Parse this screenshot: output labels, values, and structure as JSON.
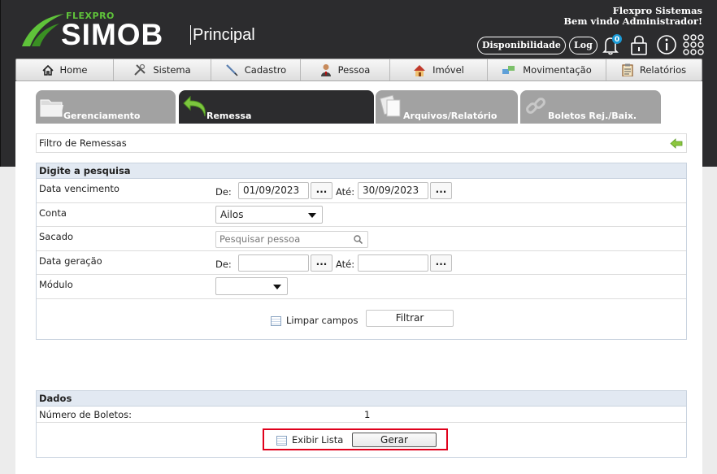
{
  "brand": {
    "small": "FLEXPRO",
    "name": "SIMOB",
    "module": "Principal"
  },
  "user": {
    "company": "Flexpro Sistemas",
    "welcome": "Bem vindo Administrador!"
  },
  "top_actions": {
    "availability": "Disponibilidade",
    "log": "Log",
    "notifications_count": "0"
  },
  "menu": [
    {
      "label": "Home",
      "icon": "home-icon"
    },
    {
      "label": "Sistema",
      "icon": "tools-icon"
    },
    {
      "label": "Cadastro",
      "icon": "pen-icon"
    },
    {
      "label": "Pessoa",
      "icon": "person-icon"
    },
    {
      "label": "Imóvel",
      "icon": "house-icon"
    },
    {
      "label": "Movimentação",
      "icon": "transfer-icon"
    },
    {
      "label": "Relatórios",
      "icon": "clipboard-icon"
    }
  ],
  "tabs": [
    {
      "label": "Gerenciamento",
      "icon": "folder-icon"
    },
    {
      "label": "Remessa",
      "icon": "return-arrow-icon",
      "active": true
    },
    {
      "label": "Arquivos/Relatório",
      "icon": "documents-icon"
    },
    {
      "label": "Boletos Rej./Baix.",
      "icon": "chain-icon"
    }
  ],
  "filter_bar": {
    "title": "Filtro de Remessas"
  },
  "search_section": {
    "title": "Digite a pesquisa",
    "data_vencimento": {
      "label": "Data vencimento",
      "from_label": "De:",
      "from_value": "01/09/2023",
      "to_label": "Até:",
      "to_value": "30/09/2023",
      "picker": "..."
    },
    "conta": {
      "label": "Conta",
      "value": "Ailos"
    },
    "sacado": {
      "label": "Sacado",
      "placeholder": "Pesquisar pessoa"
    },
    "data_geracao": {
      "label": "Data geração",
      "from_label": "De:",
      "from_value": "",
      "to_label": "Até:",
      "to_value": "",
      "picker": "..."
    },
    "modulo": {
      "label": "Módulo",
      "value": ""
    },
    "clear_label": "Limpar campos",
    "filter_button": "Filtrar"
  },
  "data_section": {
    "title": "Dados",
    "count_label": "Número de Boletos:",
    "count_value": "1",
    "show_list_label": "Exibir Lista",
    "generate_button": "Gerar"
  },
  "colors": {
    "dark": "#2c2c2e",
    "brand_green": "#5fc33a",
    "section_header": "#e2e9f2",
    "highlight": "#e0001b"
  }
}
